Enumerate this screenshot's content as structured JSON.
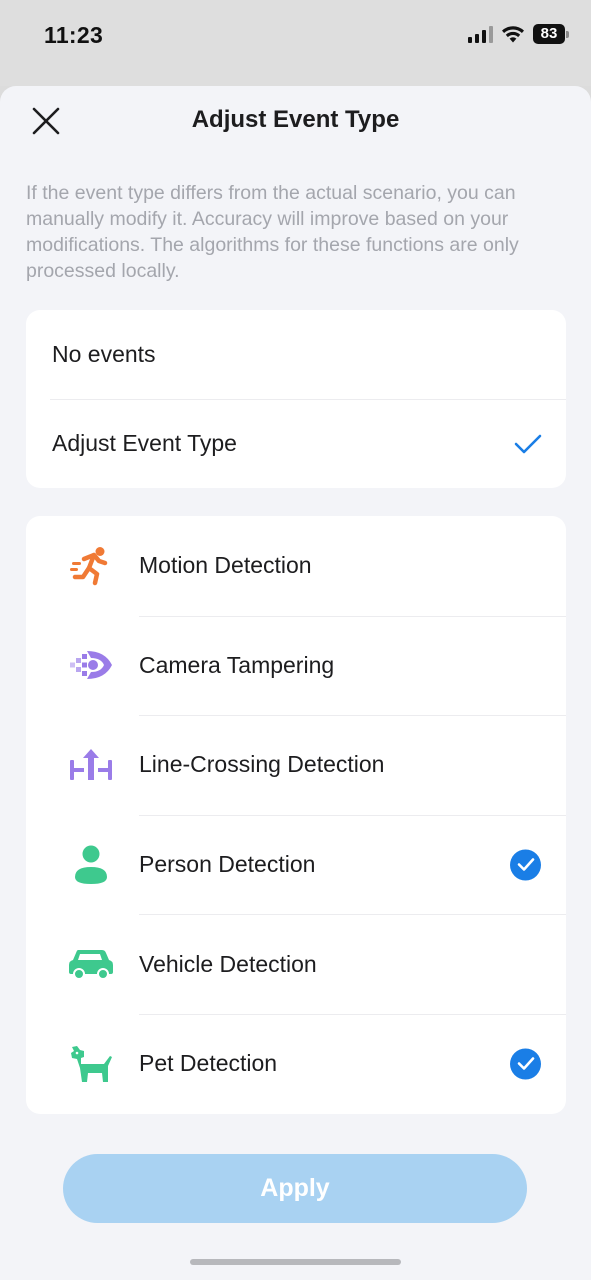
{
  "status_bar": {
    "time": "11:23",
    "battery": "83"
  },
  "header": {
    "title": "Adjust Event Type"
  },
  "description": "If the event type differs from the actual scenario, you can manually modify it. Accuracy will improve based on your modifications. The algorithms for these functions are only processed locally.",
  "mode_options": [
    {
      "label": "No events",
      "selected": false
    },
    {
      "label": "Adjust Event Type",
      "selected": true
    }
  ],
  "event_types": [
    {
      "label": "Motion Detection",
      "icon": "running-person-icon",
      "color": "#f07a35",
      "checked": false
    },
    {
      "label": "Camera Tampering",
      "icon": "camera-tamper-icon",
      "color": "#9a7ce8",
      "checked": false
    },
    {
      "label": "Line-Crossing Detection",
      "icon": "line-crossing-icon",
      "color": "#9a7ce8",
      "checked": false
    },
    {
      "label": "Person Detection",
      "icon": "person-icon",
      "color": "#3ec98e",
      "checked": true
    },
    {
      "label": "Vehicle Detection",
      "icon": "car-icon",
      "color": "#3ec98e",
      "checked": false
    },
    {
      "label": "Pet Detection",
      "icon": "dog-icon",
      "color": "#3ec98e",
      "checked": true
    }
  ],
  "apply_label": "Apply",
  "colors": {
    "accent": "#1a7ee6",
    "apply_disabled": "#a9d2f2"
  }
}
